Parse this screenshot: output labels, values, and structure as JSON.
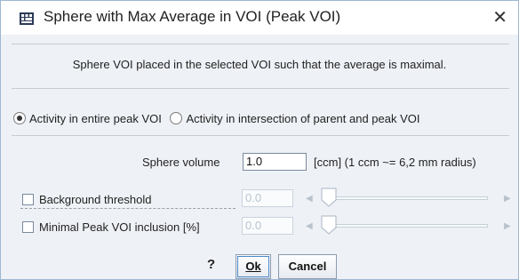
{
  "window": {
    "title": "Sphere with Max Average in VOI (Peak VOI)",
    "close_glyph": "✕",
    "title_icon": "grid-app-icon"
  },
  "description": "Sphere VOI placed in the selected VOI such that the average is maximal.",
  "radios": [
    {
      "label": "Activity in entire peak VOI",
      "checked": true
    },
    {
      "label": "Activity in intersection of parent and peak VOI",
      "checked": false
    }
  ],
  "sphere": {
    "label": "Sphere volume",
    "value": "1.0",
    "unit": "[ccm]  (1 ccm ~= 6,2 mm radius)"
  },
  "background_threshold": {
    "label": "Background threshold",
    "checked": false,
    "value": "0.0"
  },
  "peak_inclusion": {
    "label": "Minimal Peak VOI inclusion [%]",
    "checked": false,
    "value": "0.0"
  },
  "buttons": {
    "help": "?",
    "ok": "Ok",
    "cancel": "Cancel"
  },
  "colors": {
    "accent": "#4d88c7",
    "background": "#eef1f6"
  }
}
